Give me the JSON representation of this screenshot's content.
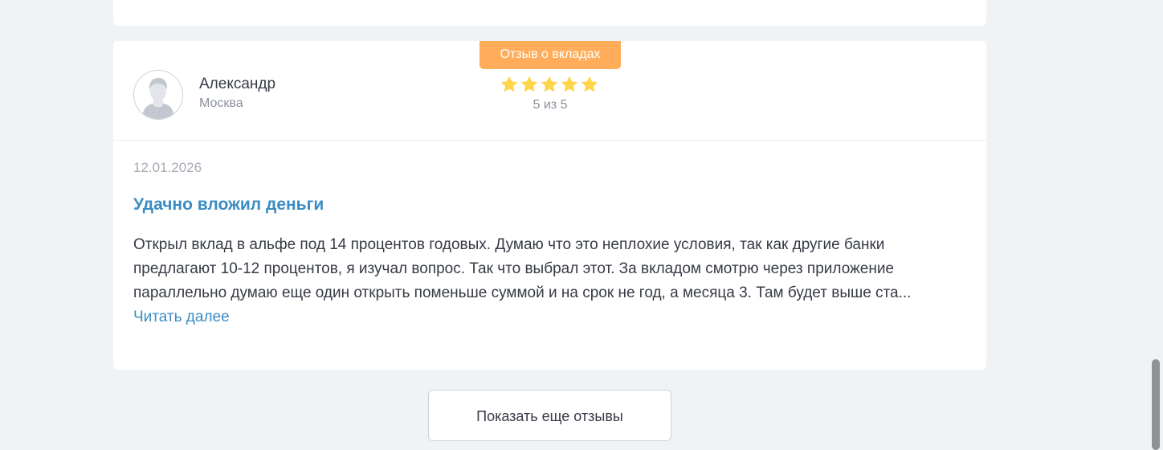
{
  "review": {
    "category": "Отзыв о вкладах",
    "author": {
      "name": "Александр",
      "city": "Москва"
    },
    "rating": {
      "value": 5,
      "max": 5,
      "text": "5 из 5"
    },
    "date": "12.01.2026",
    "title": "Удачно вложил деньги",
    "text_lines": [
      "Открыл вклад в альфе под 14 процентов годовых. Думаю что это неплохие условия, так как другие банки",
      "предлагают 10-12 процентов, я изучал вопрос. Так что выбрал этот. За вкладом смотрю через приложение",
      "параллельно думаю еще один открыть поменьше суммой и на срок не год, а месяца 3. Там будет выше ста..."
    ],
    "read_more": "Читать далее"
  },
  "show_more_button": "Показать еще отзывы",
  "colors": {
    "accent_link": "#3a8cc4",
    "badge": "#ffad5a",
    "star": "#ffd54a"
  },
  "icons": {
    "avatar": "user-silhouette-icon",
    "star": "star-icon"
  }
}
